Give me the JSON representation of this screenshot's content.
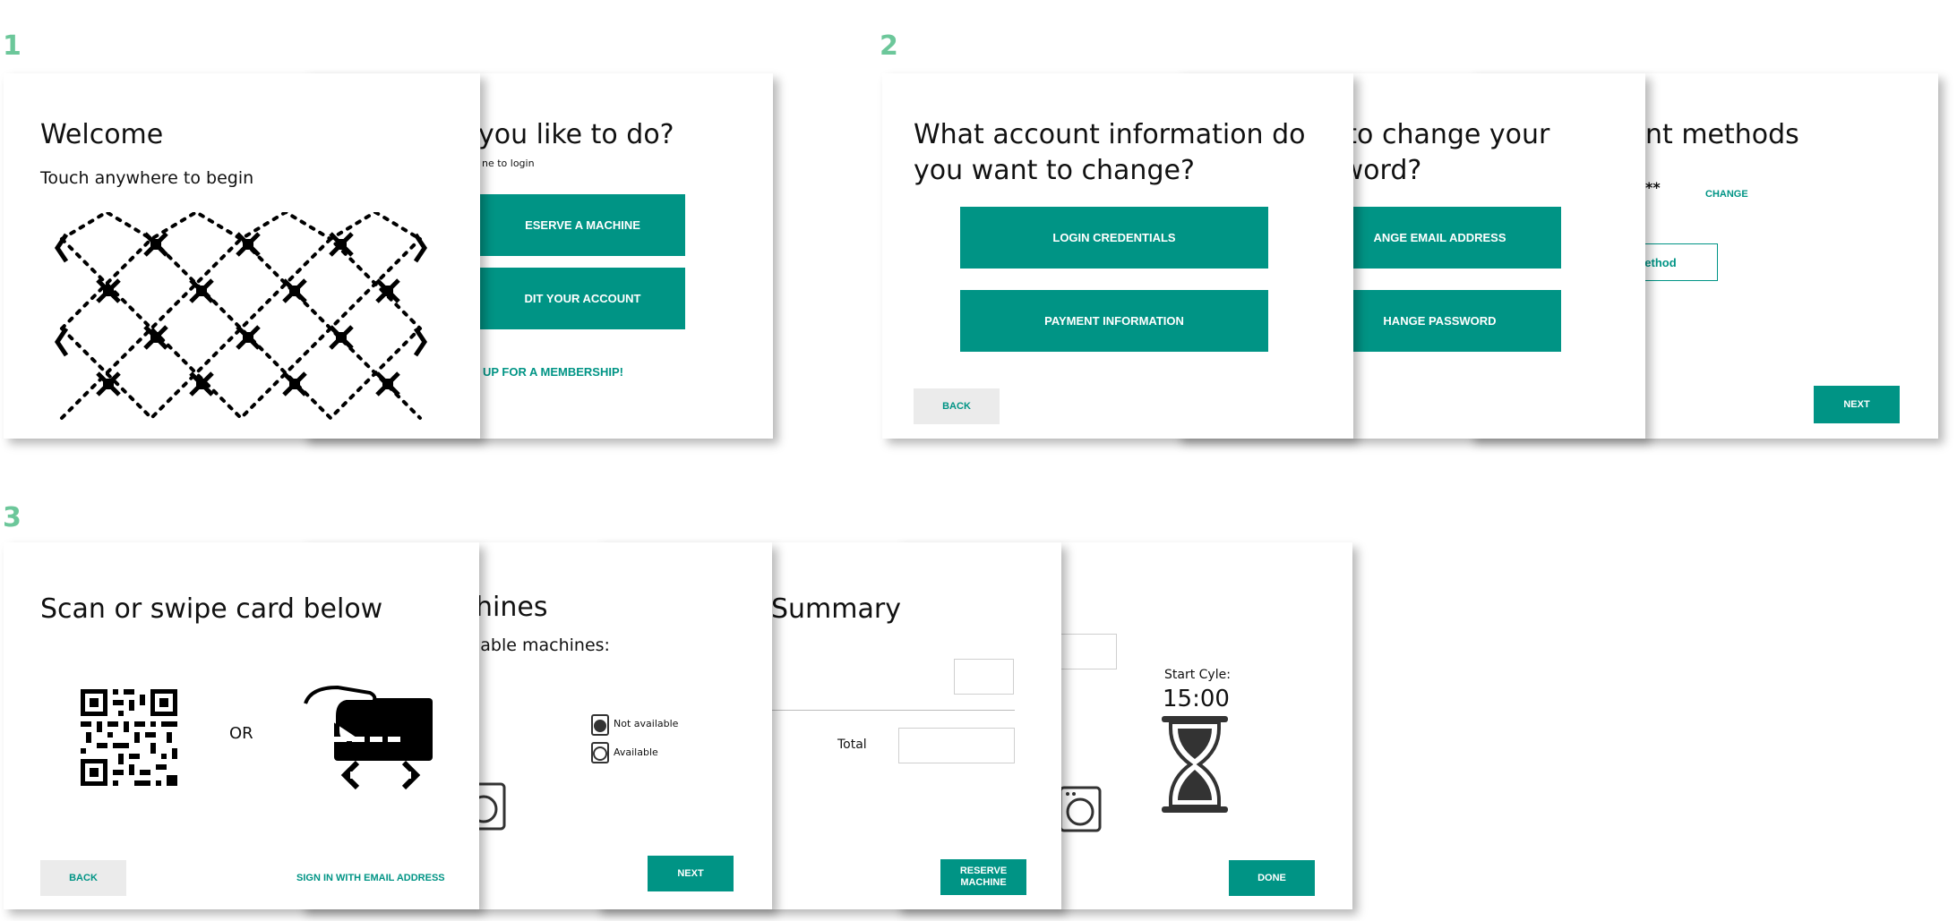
{
  "flows": {
    "f1": {
      "number": "1"
    },
    "f2": {
      "number": "2"
    },
    "f3": {
      "number": "3"
    }
  },
  "welcome": {
    "title": "Welcome",
    "subtitle": "Touch anywhere to begin"
  },
  "home": {
    "title": "you like to do?",
    "hint": "ne to login",
    "reserve_label": "ESERVE A MACHINE",
    "edit_label": "DIT YOUR ACCOUNT",
    "membership_link": "UP FOR A MEMBERSHIP!"
  },
  "account": {
    "title_line1": "What account information do",
    "title_line2": "you want to change?",
    "login_label": "LOGIN CREDENTIALS",
    "payment_label": "PAYMENT INFORMATION",
    "back_label": "BACK"
  },
  "credentials": {
    "title_line1": "t to change your",
    "title_line2": "sword?",
    "email_label": "ANGE EMAIL ADDRESS",
    "password_label": "HANGE PASSWORD"
  },
  "payment": {
    "title": "nt methods",
    "masked": "**",
    "change_link": "CHANGE",
    "method_label": "ethod",
    "next_label": "NEXT"
  },
  "scan": {
    "title": "Scan or swipe card below",
    "or_label": "OR",
    "back_label": "BACK",
    "email_link": "SIGN IN WITH EMAIL ADDRESS"
  },
  "machines": {
    "title": "hines",
    "subtitle": "lable machines:",
    "legend_unavailable": "Not available",
    "legend_available": "Available",
    "next_label": "NEXT"
  },
  "summary": {
    "title": "Summary",
    "total_label": "Total",
    "reserve_label": "RESERVE MACHINE"
  },
  "cycle": {
    "start_label": "Start Cyle:",
    "time": "15:00",
    "done_label": "DONE"
  },
  "colors": {
    "accent": "#009485",
    "flow_number": "#6cc79a",
    "ghost_button": "#ebebeb"
  }
}
